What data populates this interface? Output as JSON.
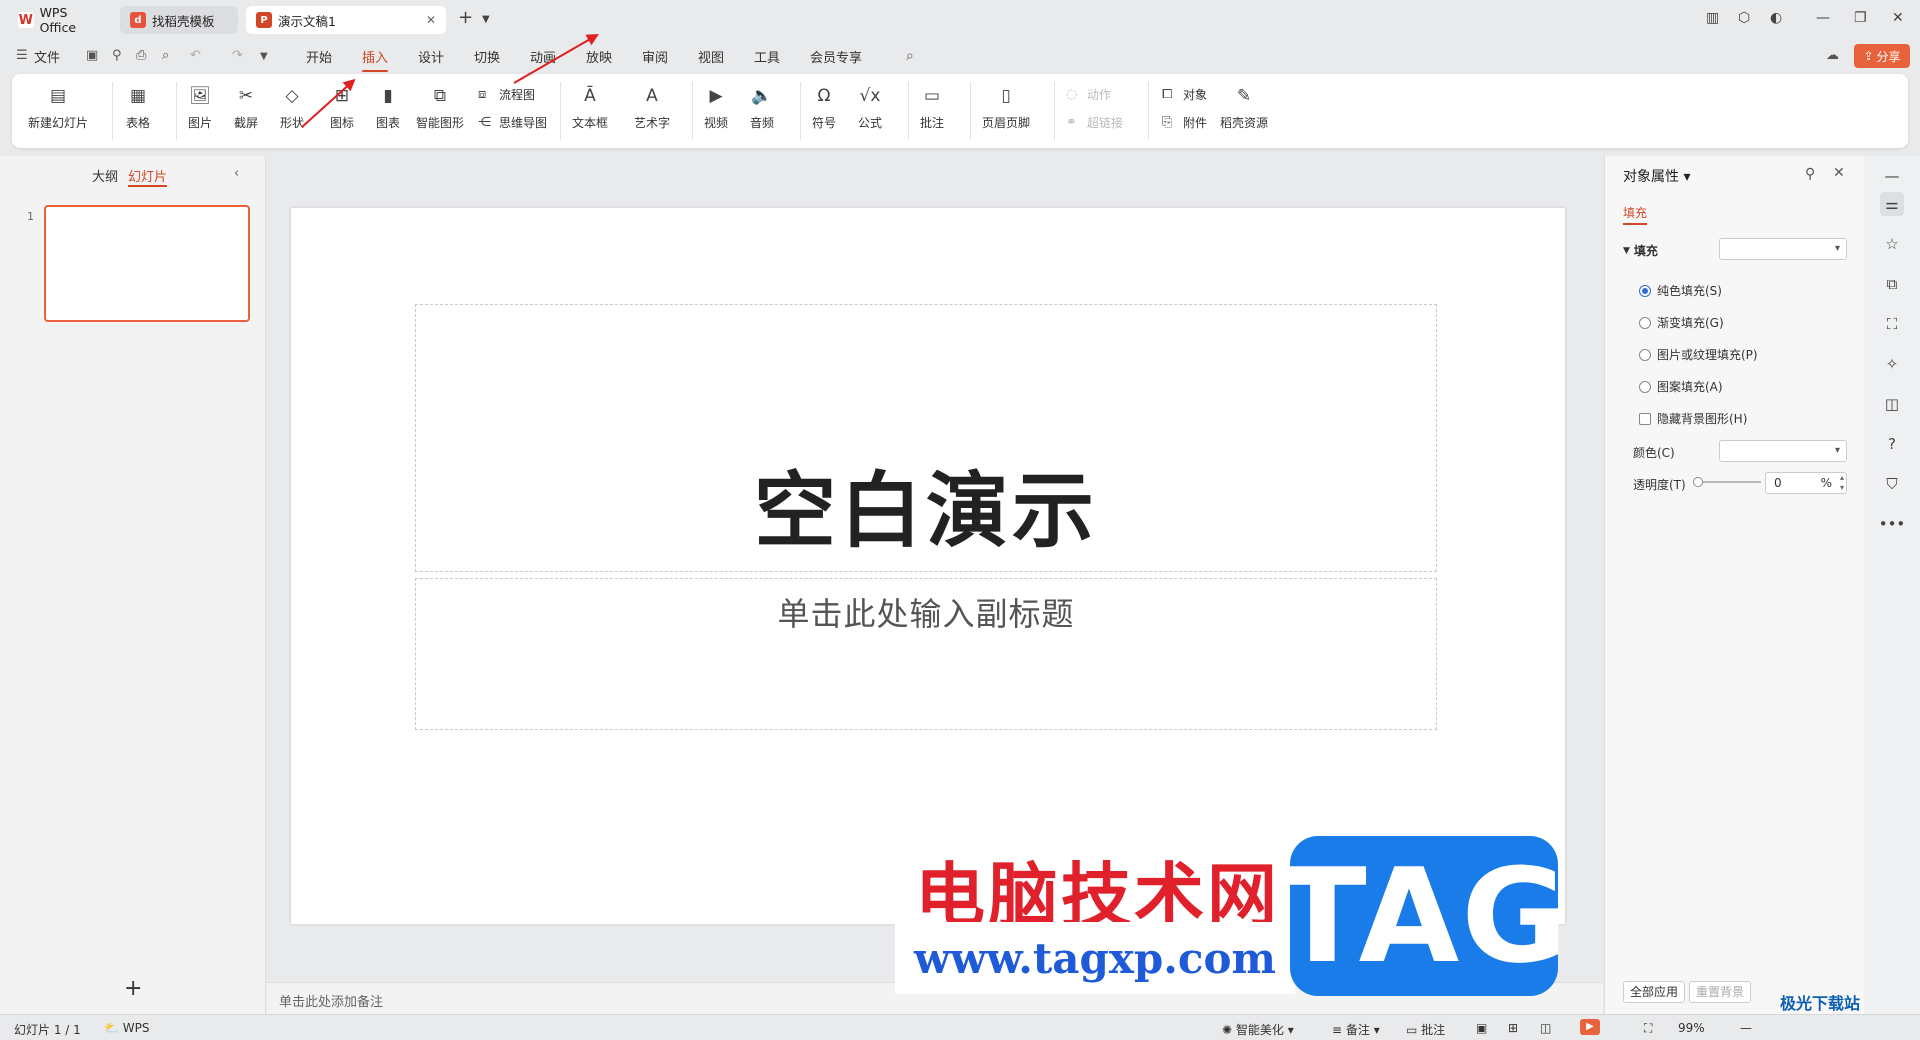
{
  "tabs": [
    {
      "label": "WPS Office",
      "icon": "wps-logo-icon"
    },
    {
      "label": "找稻壳模板",
      "icon": "docer-icon"
    },
    {
      "label": "演示文稿1",
      "icon": "ppt-icon"
    }
  ],
  "menubar": {
    "file": "文件",
    "items": [
      "开始",
      "插入",
      "设计",
      "切换",
      "动画",
      "放映",
      "审阅",
      "视图",
      "工具",
      "会员专享"
    ],
    "active": "插入",
    "share": "分享"
  },
  "ribbon": {
    "new_slide": "新建幻灯片",
    "table": "表格",
    "picture": "图片",
    "screenshot": "截屏",
    "shape": "形状",
    "icon": "图标",
    "chart": "图表",
    "smart_graphic": "智能图形",
    "flowchart": "流程图",
    "mindmap": "思维导图",
    "textbox": "文本框",
    "wordart": "艺术字",
    "video": "视频",
    "audio": "音频",
    "symbol": "符号",
    "formula": "公式",
    "comment": "批注",
    "header_footer": "页眉页脚",
    "action": "动作",
    "hyperlink": "超链接",
    "object": "对象",
    "attachment": "附件",
    "docer_resources": "稻壳资源"
  },
  "left_panel": {
    "tab_outline": "大纲",
    "tab_slides": "幻灯片",
    "slide_number": "1",
    "add": "+"
  },
  "slide": {
    "title": "空白演示",
    "subtitle": "单击此处输入副标题"
  },
  "notes_placeholder": "单击此处添加备注",
  "properties": {
    "title": "对象属性",
    "tab": "填充",
    "section": "填充",
    "options": [
      "纯色填充(S)",
      "渐变填充(G)",
      "图片或纹理填充(P)",
      "图案填充(A)"
    ],
    "selected_option": "纯色填充(S)",
    "hide_bg": "隐藏背景图形(H)",
    "color_label": "颜色(C)",
    "transparency_label": "透明度(T)",
    "transparency_value": "0",
    "transparency_unit": "%",
    "apply_all": "全部应用",
    "reset_bg": "重置背景"
  },
  "statusbar": {
    "slide_info": "幻灯片 1 / 1",
    "wps": "WPS",
    "beautify": "智能美化",
    "notes": "备注",
    "comments": "批注",
    "zoom": "99%"
  },
  "watermark": {
    "site_name": "电脑技术网",
    "url": "www.tagxp.com",
    "tag": "TAG",
    "corner": "极光下载站"
  },
  "colors": {
    "accent": "#d24726",
    "share": "#e8633b",
    "arrow": "#e02020"
  }
}
